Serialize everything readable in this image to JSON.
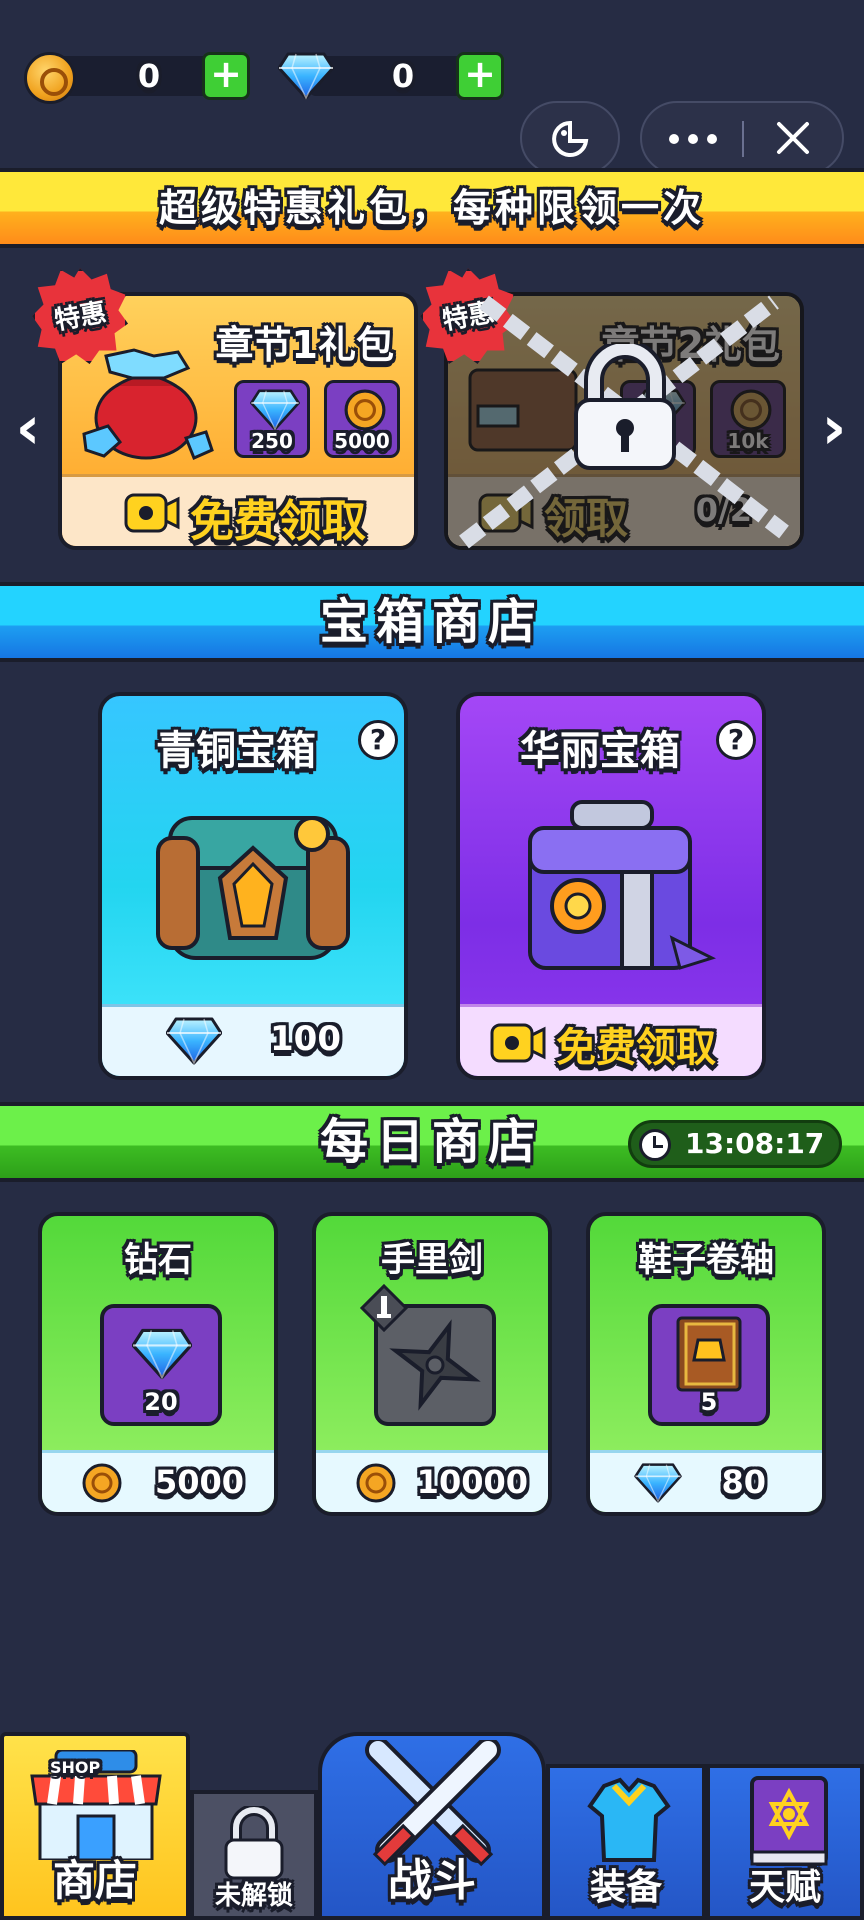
{
  "currency": {
    "coins": "0",
    "gems": "0"
  },
  "window_controls": {
    "icons": [
      "game-capsule-icon",
      "more-icon",
      "close-icon"
    ]
  },
  "special_offer_banner": "超级特惠礼包，每种限领一次",
  "packs": [
    {
      "badge": "特惠",
      "title": "章节1礼包",
      "rewards": [
        {
          "icon": "gem-icon",
          "amount": "250"
        },
        {
          "icon": "coin-icon",
          "amount": "5000"
        }
      ],
      "button": "免费领取",
      "locked": false
    },
    {
      "badge": "特惠",
      "title": "章节2礼包",
      "rewards": [
        {
          "icon": "gem-icon",
          "amount": ""
        },
        {
          "icon": "coin-icon",
          "amount": "10k"
        }
      ],
      "button": "领取",
      "progress": "0/2",
      "locked": true
    }
  ],
  "chest_shop": {
    "title": "宝箱商店",
    "chests": [
      {
        "name": "青铜宝箱",
        "price": "100",
        "price_icon": "gem-icon"
      },
      {
        "name": "华丽宝箱",
        "button": "免费领取"
      }
    ]
  },
  "daily_shop": {
    "title": "每日商店",
    "timer": "13:08:17",
    "items": [
      {
        "name": "钻石",
        "quantity": "20",
        "price": "5000",
        "price_icon": "coin-icon"
      },
      {
        "name": "手里剑",
        "price": "10000",
        "price_icon": "coin-icon"
      },
      {
        "name": "鞋子卷轴",
        "quantity": "5",
        "price": "80",
        "price_icon": "gem-icon"
      }
    ]
  },
  "nav": {
    "shop_sign": "SHOP",
    "tabs": [
      "商店",
      "未解锁",
      "战斗",
      "装备",
      "天赋"
    ],
    "active": "商店"
  },
  "colors": {
    "background": "#262c44",
    "accent_yellow": "#ffd53a",
    "accent_cyan": "#23c6ff",
    "accent_green": "#4fd733",
    "purple": "#7b3fc2"
  }
}
